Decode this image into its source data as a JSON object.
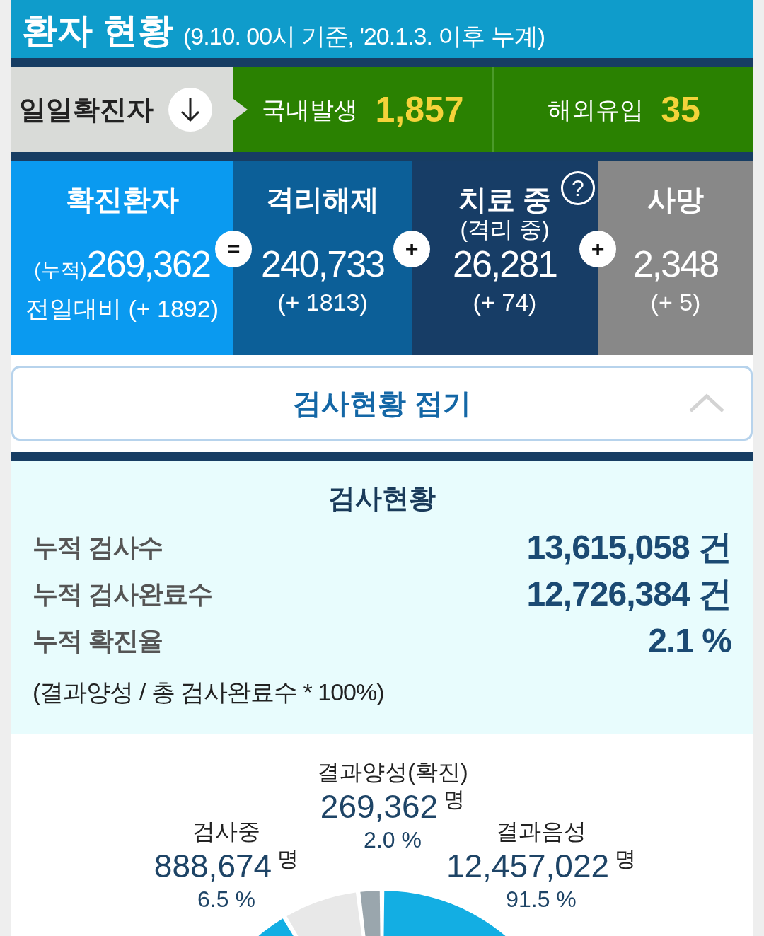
{
  "header": {
    "title": "환자 현황",
    "subtitle": "(9.10. 00시 기준, '20.1.3. 이후 누계)"
  },
  "daily": {
    "label": "일일확진자",
    "items": [
      {
        "label": "국내발생",
        "value": "1,857"
      },
      {
        "label": "해외유입",
        "value": "35"
      }
    ]
  },
  "stats": [
    {
      "kind": "confirmed",
      "title": "확진환자",
      "prefix": "(누적)",
      "value": "269,362",
      "change": "전일대비 (+ 1892)",
      "operator": "="
    },
    {
      "kind": "released",
      "title": "격리해제",
      "value": "240,733",
      "change": "(+ 1813)",
      "operator": "+"
    },
    {
      "kind": "treating",
      "title": "치료 중",
      "subtitle": "(격리 중)",
      "value": "26,281",
      "change": "(+ 74)",
      "operator": "+",
      "help": "?"
    },
    {
      "kind": "deaths",
      "title": "사망",
      "value": "2,348",
      "change": "(+ 5)"
    }
  ],
  "toggle": {
    "label": "검사현황 접기",
    "expanded": true
  },
  "tests": {
    "title": "검사현황",
    "rows": [
      {
        "label": "누적 검사수",
        "value": "13,615,058 건"
      },
      {
        "label": "누적 검사완료수",
        "value": "12,726,384 건"
      },
      {
        "label": "누적 확진율",
        "value": "2.1 %"
      }
    ],
    "note": "(결과양성 / 총 검사완료수 * 100%)"
  },
  "pie_labels": [
    {
      "kind": "testing",
      "label": "검사중",
      "value": "888,674",
      "unit": "명",
      "percent": "6.5 %"
    },
    {
      "kind": "positive",
      "label": "결과양성(확진)",
      "value": "269,362",
      "unit": "명",
      "percent": "2.0 %"
    },
    {
      "kind": "negative",
      "label": "결과음성",
      "value": "12,457,022",
      "unit": "명",
      "percent": "91.5 %"
    }
  ]
}
